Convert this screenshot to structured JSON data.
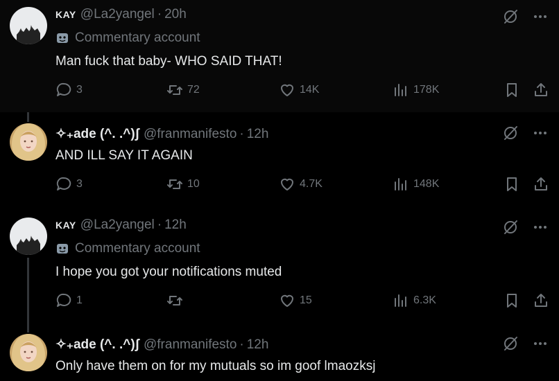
{
  "tweets": [
    {
      "name": "KAY",
      "handle": "@La2yangel",
      "time": "20h",
      "label": "Commentary account",
      "text": "Man fuck that baby- WHO SAID THAT!",
      "replies": "3",
      "retweets": "72",
      "likes": "14K",
      "views": "178K"
    },
    {
      "name": "✧₊ade (^. .^)ʃ",
      "handle": "@franmanifesto",
      "time": "12h",
      "text": "AND ILL SAY IT AGAIN",
      "replies": "3",
      "retweets": "10",
      "likes": "4.7K",
      "views": "148K"
    },
    {
      "name": "KAY",
      "handle": "@La2yangel",
      "time": "12h",
      "label": "Commentary account",
      "text": "I hope you got your notifications muted",
      "replies": "1",
      "retweets": "",
      "likes": "15",
      "views": "6.3K"
    },
    {
      "name": "✧₊ade (^. .^)ʃ",
      "handle": "@franmanifesto",
      "time": "12h",
      "text": "Only have them on for my mutuals so im goof lmaozksj"
    }
  ],
  "colors": {
    "background": "#000000",
    "text": "#e7e9ea",
    "muted": "#71767b",
    "line": "#333639"
  },
  "icons": [
    "reply-icon",
    "retweet-icon",
    "like-icon",
    "views-icon",
    "bookmark-icon",
    "share-icon",
    "grok-icon",
    "more-icon",
    "mask-icon"
  ]
}
